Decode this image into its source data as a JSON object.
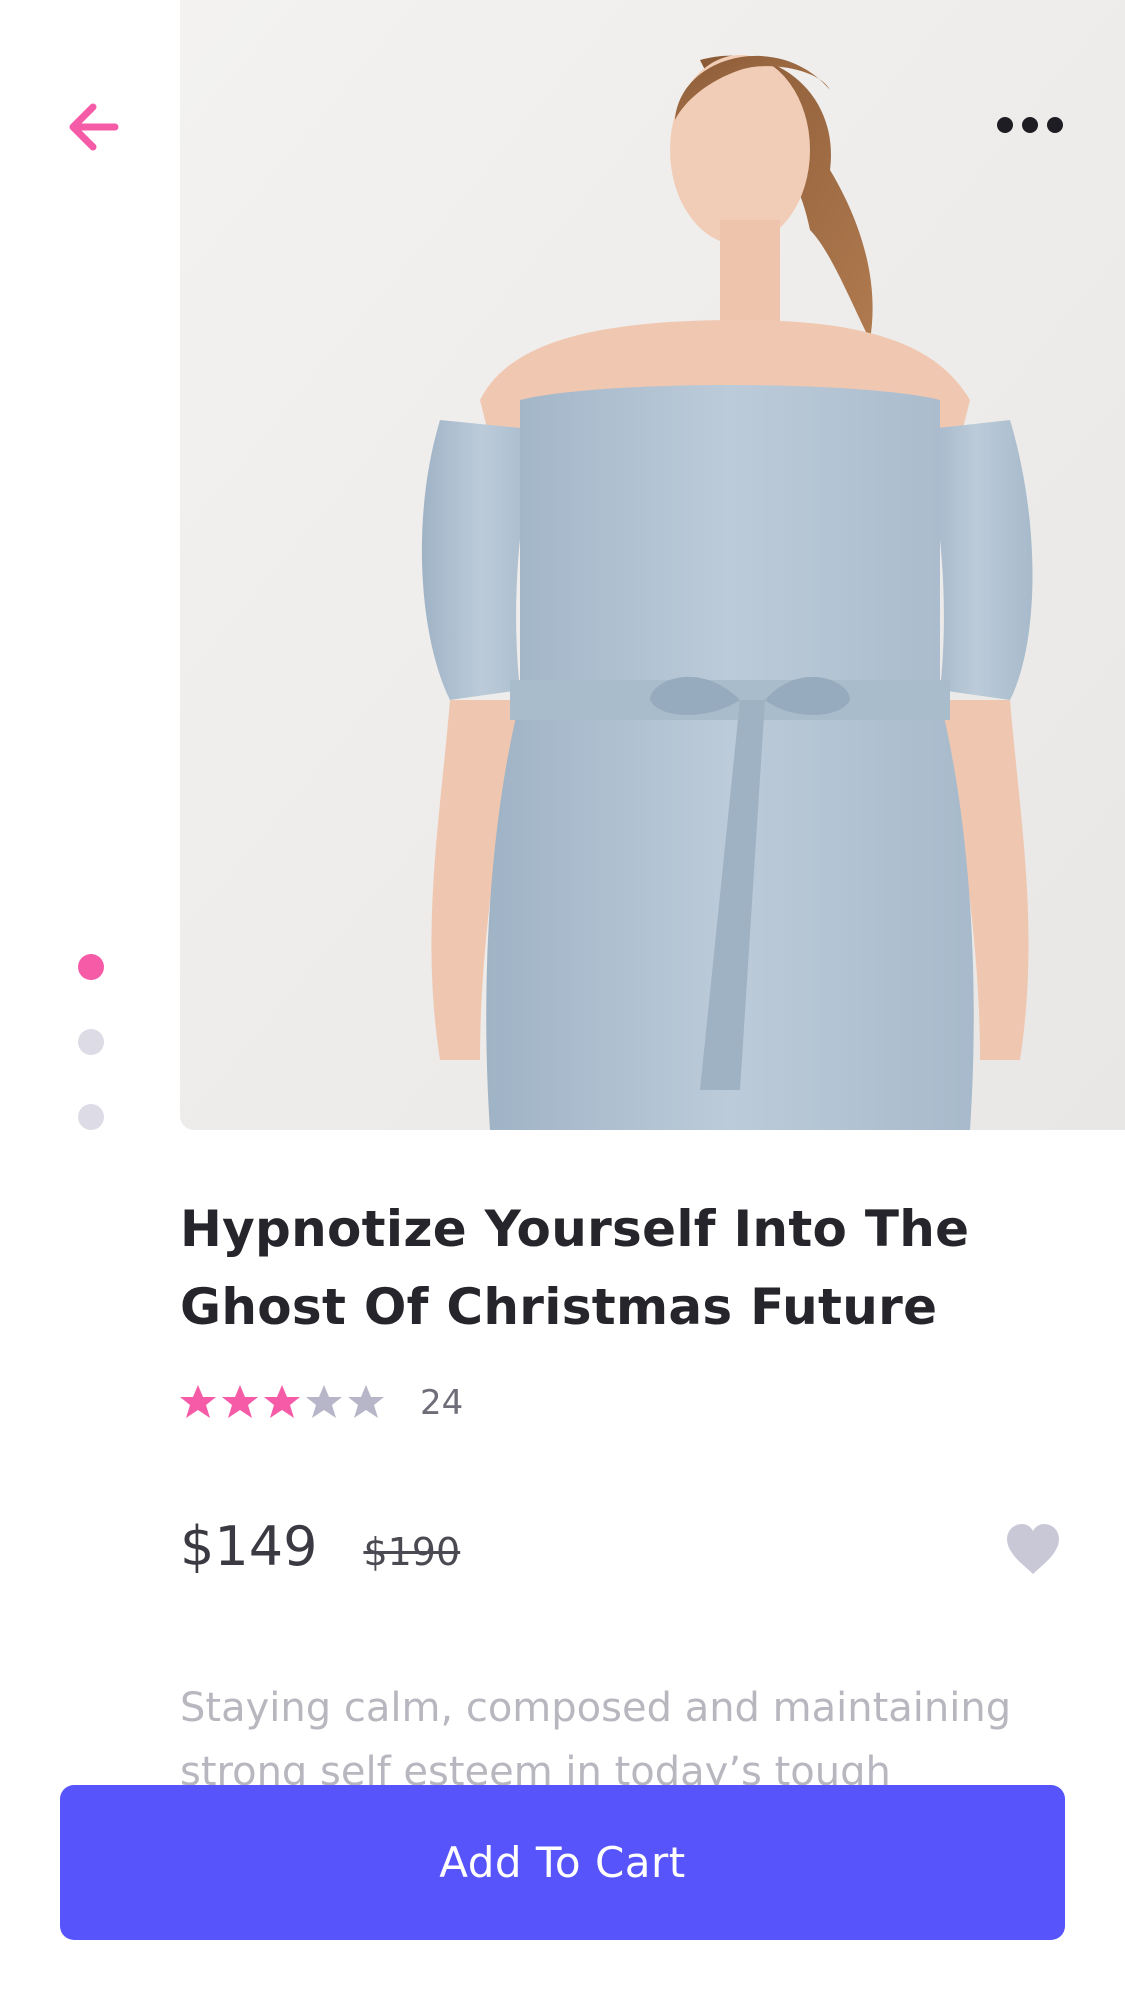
{
  "product": {
    "title": "Hypnotize Yourself Into The Ghost Of Christmas Future",
    "rating": 3,
    "rating_max": 5,
    "review_count": "24",
    "price": "$149",
    "old_price": "$190",
    "description": "Staying calm, composed and maintaining strong self esteem in today’s tough"
  },
  "carousel": {
    "total": 3,
    "active_index": 0
  },
  "actions": {
    "add_to_cart_label": "Add To Cart"
  },
  "icons": {
    "back": "arrow-left-icon",
    "more": "more-horizontal-icon",
    "favorite": "heart-icon",
    "star": "star-icon"
  },
  "colors": {
    "accent_pink": "#f55ba7",
    "primary_button": "#5754fb",
    "inactive": "#dcdbe6",
    "star_inactive": "#b7b6c8",
    "heart": "#c9c8d6",
    "title_text": "#26252b",
    "description_text": "#b8b7bf"
  }
}
